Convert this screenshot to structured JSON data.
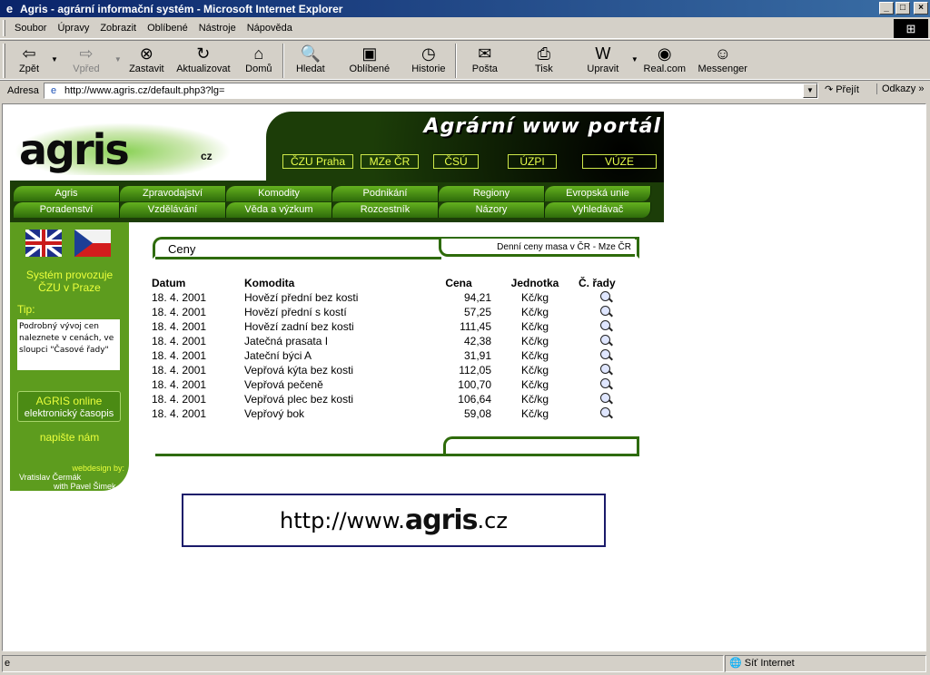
{
  "window": {
    "title": "Agris - agrární informační systém - Microsoft Internet Explorer",
    "min": "_",
    "max": "□",
    "close": "×"
  },
  "menu": [
    "Soubor",
    "Úpravy",
    "Zobrazit",
    "Oblíbené",
    "Nástroje",
    "Nápověda"
  ],
  "toolbar": {
    "back": "Zpět",
    "forward": "Vpřed",
    "stop": "Zastavit",
    "refresh": "Aktualizovat",
    "home": "Domů",
    "search": "Hledat",
    "favorites": "Oblíbené",
    "history": "Historie",
    "mail": "Pošta",
    "print": "Tisk",
    "edit": "Upravit",
    "real": "Real.com",
    "messenger": "Messenger"
  },
  "address": {
    "label": "Adresa",
    "url": "http://www.agris.cz/default.php3?lg=",
    "go": "Přejít",
    "links": "Odkazy"
  },
  "page": {
    "portal_title": "Agrární www portál",
    "logo_text": "agris",
    "logo_tld": "cz",
    "ext_links": [
      "ČZU Praha",
      "MZe ČR",
      "ČSÚ",
      "ÚZPI",
      "VÚZE"
    ],
    "nav_row1": [
      "Agris",
      "Zpravodajství",
      "Komodity",
      "Podnikání",
      "Regiony",
      "Evropská unie"
    ],
    "nav_row2": [
      "Poradenství",
      "Vzdělávání",
      "Věda a výzkum",
      "Rozcestník",
      "Názory",
      "Vyhledávač"
    ],
    "sidebar": {
      "system_line1": "Systém provozuje",
      "system_line2": "ČZU v Praze",
      "tip_label": "Tip:",
      "tip_text": "Podrobný vývoj cen naleznete v cenách, ve sloupci \"Časové řady\"",
      "online_line1": "AGRIS online",
      "online_line2": "elektronický časopis",
      "write_us": "napište nám",
      "credits_by": "webdesign by:",
      "credits_line1": "Vratislav Čermák",
      "credits_line2": "with Pavel Šimek"
    },
    "content": {
      "title": "Ceny",
      "subtitle": "Denní ceny masa v ČR - Mze ČR",
      "headers": [
        "Datum",
        "Komodita",
        "Cena",
        "Jednotka",
        "Č. řady"
      ],
      "rows": [
        {
          "date": "18. 4. 2001",
          "commodity": "Hovězí přední bez kosti",
          "price": "94,21",
          "unit": "Kč/kg"
        },
        {
          "date": "18. 4. 2001",
          "commodity": "Hovězí přední s kostí",
          "price": "57,25",
          "unit": "Kč/kg"
        },
        {
          "date": "18. 4. 2001",
          "commodity": "Hovězí zadní bez kosti",
          "price": "111,45",
          "unit": "Kč/kg"
        },
        {
          "date": "18. 4. 2001",
          "commodity": "Jatečná prasata I",
          "price": "42,38",
          "unit": "Kč/kg"
        },
        {
          "date": "18. 4. 2001",
          "commodity": "Jateční býci A",
          "price": "31,91",
          "unit": "Kč/kg"
        },
        {
          "date": "18. 4. 2001",
          "commodity": "Vepřová kýta bez kosti",
          "price": "112,05",
          "unit": "Kč/kg"
        },
        {
          "date": "18. 4. 2001",
          "commodity": "Vepřová pečeně",
          "price": "100,70",
          "unit": "Kč/kg"
        },
        {
          "date": "18. 4. 2001",
          "commodity": "Vepřová plec bez kosti",
          "price": "106,64",
          "unit": "Kč/kg"
        },
        {
          "date": "18. 4. 2001",
          "commodity": "Vepřový bok",
          "price": "59,08",
          "unit": "Kč/kg"
        }
      ]
    },
    "banner": {
      "prefix": "http://www.",
      "brand": "agris",
      "suffix": ".cz"
    }
  },
  "status": {
    "main": "",
    "zone": "Síť Internet"
  },
  "colors": {
    "dark_green": "#1c3d08",
    "mid_green": "#5d9c1e",
    "yellow_text": "#eaff3c"
  }
}
